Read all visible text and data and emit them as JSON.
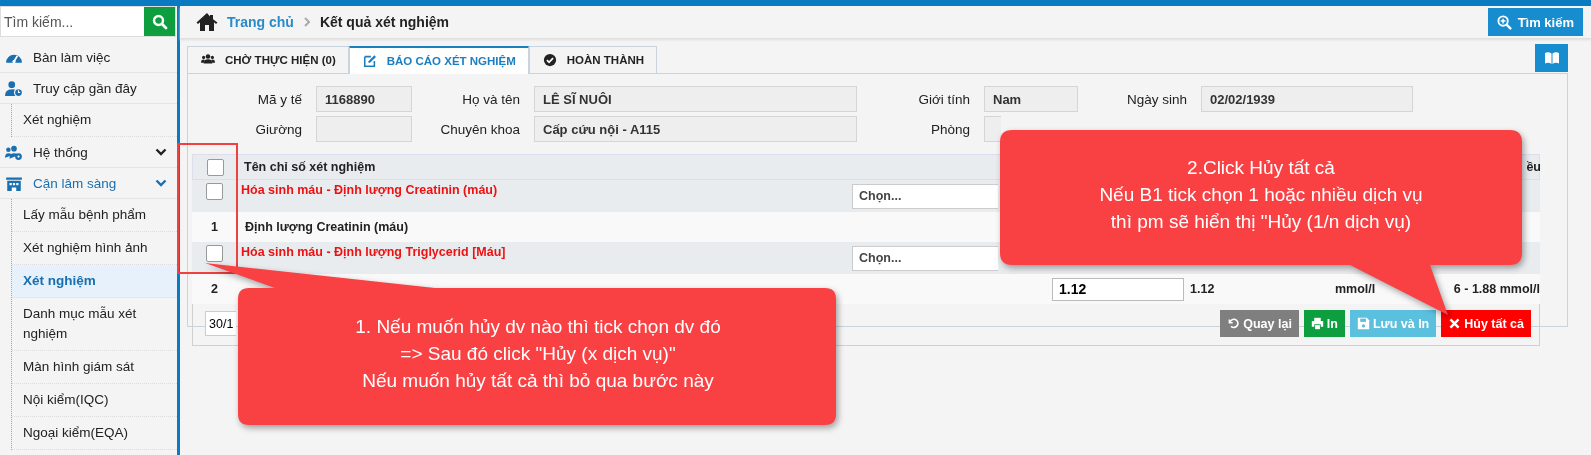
{
  "sidebar": {
    "search": {
      "placeholder": "Tìm kiếm..."
    },
    "items": [
      {
        "label": "Bàn làm việc",
        "selected": false
      },
      {
        "label": "Truy cập gần đây",
        "selected": false,
        "children": [
          {
            "label": "Xét nghiệm",
            "selected": false
          }
        ]
      },
      {
        "label": "Hệ thống",
        "selected": false,
        "expanded": true
      },
      {
        "label": "Cận lâm sàng",
        "selected": true,
        "expanded": true,
        "children": [
          {
            "label": "Lấy mẫu bệnh phẩm",
            "selected": false
          },
          {
            "label": "Xét nghiệm hình ảnh",
            "selected": false
          },
          {
            "label": "Xét nghiệm",
            "selected": true
          },
          {
            "label": "Danh mục mẫu xét nghiệm",
            "selected": false
          },
          {
            "label": "Màn hình giám sát",
            "selected": false
          },
          {
            "label": "Nội kiểm(IQC)",
            "selected": false
          },
          {
            "label": "Ngoại kiểm(EQA)",
            "selected": false
          }
        ]
      }
    ]
  },
  "breadcrumb": [
    {
      "label": "Trang chủ",
      "kind": "link"
    },
    {
      "label": "Kết quả xét nghiệm",
      "kind": "current"
    }
  ],
  "search_button": "Tìm kiếm",
  "tabs": [
    {
      "label": "CHỜ THỰC HIỆN (0)",
      "selected": false
    },
    {
      "label": "BÁO CÁO XÉT NGHIỆM",
      "selected": true
    },
    {
      "label": "HOÀN THÀNH",
      "selected": false
    }
  ],
  "patient_fields": [
    {
      "label": "Mã y tế",
      "value": "1168890"
    },
    {
      "label": "Họ và tên",
      "value": "LÊ SĨ NUÔI"
    },
    {
      "label": "Giới tính",
      "value": "Nam"
    },
    {
      "label": "Ngày sinh",
      "value": "02/02/1939"
    },
    {
      "label": "Giường"
    },
    {
      "label": "Chuyên khoa",
      "value": "Cấp cứu nội - A115"
    },
    {
      "label": "Phòng"
    }
  ],
  "table": {
    "header": {
      "checked": false,
      "column_2": "Tên chỉ số xét nghiệm",
      "column_7": "ều"
    },
    "rows": [
      {
        "kind": "group",
        "checked": false,
        "name": "Hóa sinh máu - Định lượng Creatinin (máu)",
        "select_placeholder": "Chọn..."
      },
      {
        "kind": "item",
        "number": "1",
        "name": "Định lượng Creatinin (máu)"
      },
      {
        "kind": "group",
        "checked": false,
        "name": "Hóa sinh máu - Định lượng Triglycerid [Máu]",
        "select_placeholder": "Chọn..."
      },
      {
        "kind": "item",
        "number": "2",
        "result": "1.12",
        "column_5": "1.12",
        "column_6": "mmol/l",
        "column_7": "6 - 1.88 mmol/l"
      }
    ]
  },
  "footer": {
    "date_field": "30/1",
    "buttons": [
      {
        "label": "Quay lại",
        "kind": "back"
      },
      {
        "label": "In",
        "kind": "print"
      },
      {
        "label": "Lưu và In",
        "kind": "save-print"
      },
      {
        "label": "Hủy tất cả",
        "kind": "cancel-all"
      }
    ]
  },
  "callouts": [
    {
      "lines": [
        "1. Nếu muốn hủy dv nào thì tick chọn dv đó",
        "=> Sau đó click \"Hủy (x dịch vụ)\"",
        "Nếu muốn hủy tất cả thì bỏ qua bước này"
      ]
    },
    {
      "lines": [
        "2.Click Hủy tất cả",
        "Nếu B1 tick chọn 1 hoặc nhiều dịch vụ",
        "thì pm sẽ hiển thị \"Hủy (1/n dịch vụ)"
      ]
    }
  ]
}
